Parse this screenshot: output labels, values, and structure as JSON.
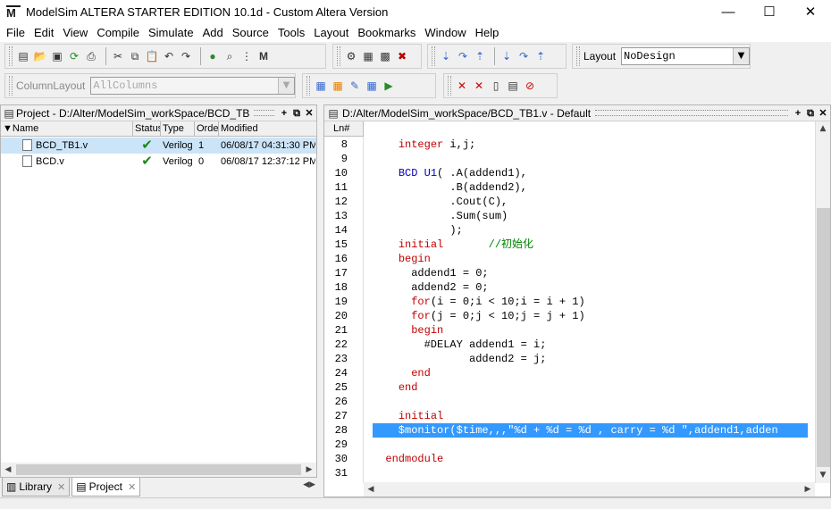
{
  "window": {
    "title": "ModelSim ALTERA STARTER EDITION 10.1d - Custom Altera Version",
    "logo": "M"
  },
  "menu": [
    "File",
    "Edit",
    "View",
    "Compile",
    "Simulate",
    "Add",
    "Source",
    "Tools",
    "Layout",
    "Bookmarks",
    "Window",
    "Help"
  ],
  "toolbar": {
    "layout_label": "Layout",
    "layout_value": "NoDesign",
    "columnlayout_label": "ColumnLayout",
    "columnlayout_value": "AllColumns"
  },
  "project_pane": {
    "title": "Project - D:/Alter/ModelSim_workSpace/BCD_TB",
    "columns": [
      "Name",
      "Status",
      "Type",
      "Order",
      "Modified"
    ],
    "rows": [
      {
        "name": "BCD_TB1.v",
        "status": "✔",
        "type": "Verilog",
        "order": "1",
        "modified": "06/08/17 04:31:30 PM",
        "selected": true
      },
      {
        "name": "BCD.v",
        "status": "✔",
        "type": "Verilog",
        "order": "0",
        "modified": "06/08/17 12:37:12 PM",
        "selected": false
      }
    ]
  },
  "bottom_tabs": [
    {
      "label": "Library",
      "active": false
    },
    {
      "label": "Project",
      "active": true
    }
  ],
  "source_pane": {
    "title": "D:/Alter/ModelSim_workSpace/BCD_TB1.v - Default",
    "ln_header": "Ln#",
    "lines": [
      {
        "n": "8",
        "t": "    integer i,j;"
      },
      {
        "n": "9",
        "t": ""
      },
      {
        "n": "10",
        "t": "    BCD U1( .A(addend1),"
      },
      {
        "n": "11",
        "t": "            .B(addend2),"
      },
      {
        "n": "12",
        "t": "            .Cout(C),"
      },
      {
        "n": "13",
        "t": "            .Sum(sum)"
      },
      {
        "n": "14",
        "t": "            );"
      },
      {
        "n": "15",
        "t": "    initial       //初始化"
      },
      {
        "n": "16",
        "t": "    begin"
      },
      {
        "n": "17",
        "t": "      addend1 = 0;"
      },
      {
        "n": "18",
        "t": "      addend2 = 0;"
      },
      {
        "n": "19",
        "t": "      for(i = 0;i < 10;i = i + 1)"
      },
      {
        "n": "20",
        "t": "      for(j = 0;j < 10;j = j + 1)"
      },
      {
        "n": "21",
        "t": "      begin"
      },
      {
        "n": "22",
        "t": "        #DELAY addend1 = i;"
      },
      {
        "n": "23",
        "t": "               addend2 = j;"
      },
      {
        "n": "24",
        "t": "      end"
      },
      {
        "n": "25",
        "t": "    end"
      },
      {
        "n": "26",
        "t": ""
      },
      {
        "n": "27",
        "t": "    initial"
      },
      {
        "n": "28",
        "t": "    $monitor($time,,,\"%d + %d = %d , carry = %d \",addend1,adden",
        "highlight": true
      },
      {
        "n": "29",
        "t": ""
      },
      {
        "n": "30",
        "t": "  endmodule"
      },
      {
        "n": "31",
        "t": ""
      }
    ]
  },
  "colors": {
    "selection": "#3399ff",
    "keyword": "#c00000",
    "builtin": "#0000c0",
    "comment": "#008000"
  }
}
